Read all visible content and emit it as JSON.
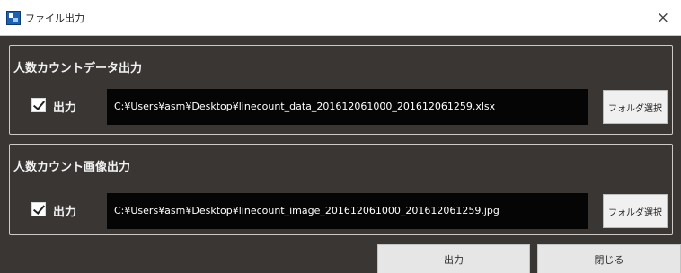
{
  "window": {
    "title": "ファイル出力",
    "close_glyph": "×",
    "icon": "app-icon"
  },
  "groups": [
    {
      "title": "人数カウントデータ出力",
      "checkbox_checked": true,
      "output_label": "出力",
      "path": "C:¥Users¥asm¥Desktop¥linecount_data_201612061000_201612061259.xlsx",
      "folder_button": "フォルダ選択"
    },
    {
      "title": "人数カウント画像出力",
      "checkbox_checked": true,
      "output_label": "出力",
      "path": "C:¥Users¥asm¥Desktop¥linecount_image_201612061000_201612061259.jpg",
      "folder_button": "フォルダ選択"
    }
  ],
  "footer": {
    "output_button": "出力",
    "close_button": "閉じる"
  },
  "colors": {
    "background": "#3a3634",
    "path_field": "#050505",
    "button": "#f0f0f0"
  }
}
